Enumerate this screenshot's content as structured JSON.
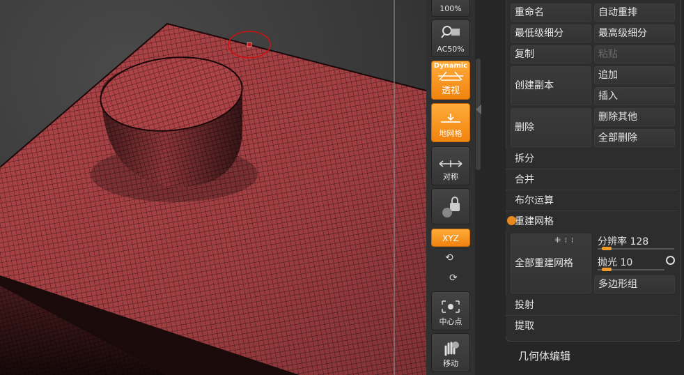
{
  "shelf": {
    "zoom_label": "100%",
    "ac_label": "AC50%",
    "perspective_badge": "Dynamic",
    "perspective_label": "透视",
    "floor_label": "地网格",
    "symmetry_label": "对称",
    "xyz_label": "XYZ",
    "center_label": "中心点",
    "move_label": "移动"
  },
  "panel": {
    "rename": "重命名",
    "auto_reorder": "自动重排",
    "lowest_subdiv": "最低级细分",
    "highest_subdiv": "最高级细分",
    "copy": "复制",
    "paste": "粘贴",
    "duplicate": "创建副本",
    "append": "追加",
    "insert": "插入",
    "delete": "删除",
    "delete_other": "删除其他",
    "delete_all": "全部删除",
    "split": "拆分",
    "merge": "合并",
    "boolean": "布尔运算",
    "remesh_section": "重建网格",
    "remesh_all": "全部重建网格",
    "resolution_label": "分辨率",
    "resolution_value": "128",
    "resolution_fraction": 0.13,
    "polish_label": "抛光",
    "polish_value": "10",
    "polish_fraction": 0.13,
    "polygroups": "多边形组",
    "project": "投射",
    "extract": "提取"
  },
  "footer": {
    "geometry_edit": "几何体编辑"
  },
  "colors": {
    "accent": "#f39a2a",
    "mesh": "#b84a4a",
    "wire": "#3a1515",
    "cursor": "#d01010"
  }
}
